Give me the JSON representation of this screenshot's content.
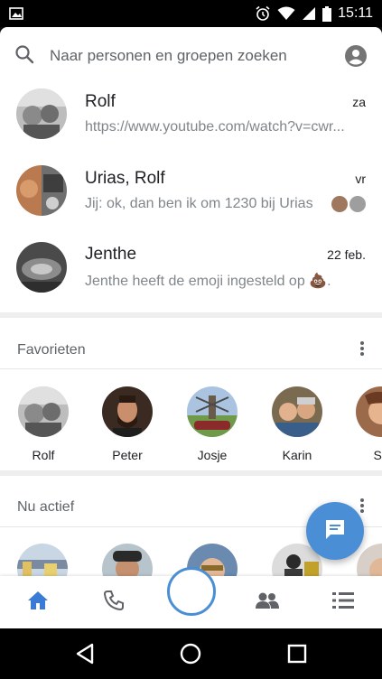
{
  "status_bar": {
    "time": "15:11",
    "icons": [
      "image-icon",
      "alarm-icon",
      "wifi-icon",
      "signal-icon",
      "battery-icon"
    ]
  },
  "search": {
    "placeholder": "Naar personen en groepen zoeken",
    "icon": "search-icon",
    "account_icon": "account-circle-icon"
  },
  "threads": [
    {
      "name": "Rolf",
      "time": "za",
      "snippet": "https://www.youtube.com/watch?v=cwr..."
    },
    {
      "name": "Urias, Rolf",
      "time": "vr",
      "snippet": "Jij: ok, dan ben ik om 1230 bij Urias"
    },
    {
      "name": "Jenthe",
      "time": "22 feb.",
      "snippet": "Jenthe heeft de emoji ingesteld op 💩."
    }
  ],
  "favorites": {
    "title": "Favorieten",
    "items": [
      {
        "name": "Rolf"
      },
      {
        "name": "Peter"
      },
      {
        "name": "Josje"
      },
      {
        "name": "Karin"
      },
      {
        "name": "Su"
      }
    ]
  },
  "active": {
    "title": "Nu actief"
  },
  "bottom_nav": {
    "items": [
      "home-icon",
      "phone-icon",
      "camera-ring-icon",
      "people-icon",
      "list-icon"
    ],
    "accent": "#4a8fd6"
  },
  "fab": {
    "icon": "new-message-icon",
    "color": "#4a8fd6"
  },
  "system_nav": [
    "back-icon",
    "home-circle-icon",
    "recents-icon"
  ]
}
